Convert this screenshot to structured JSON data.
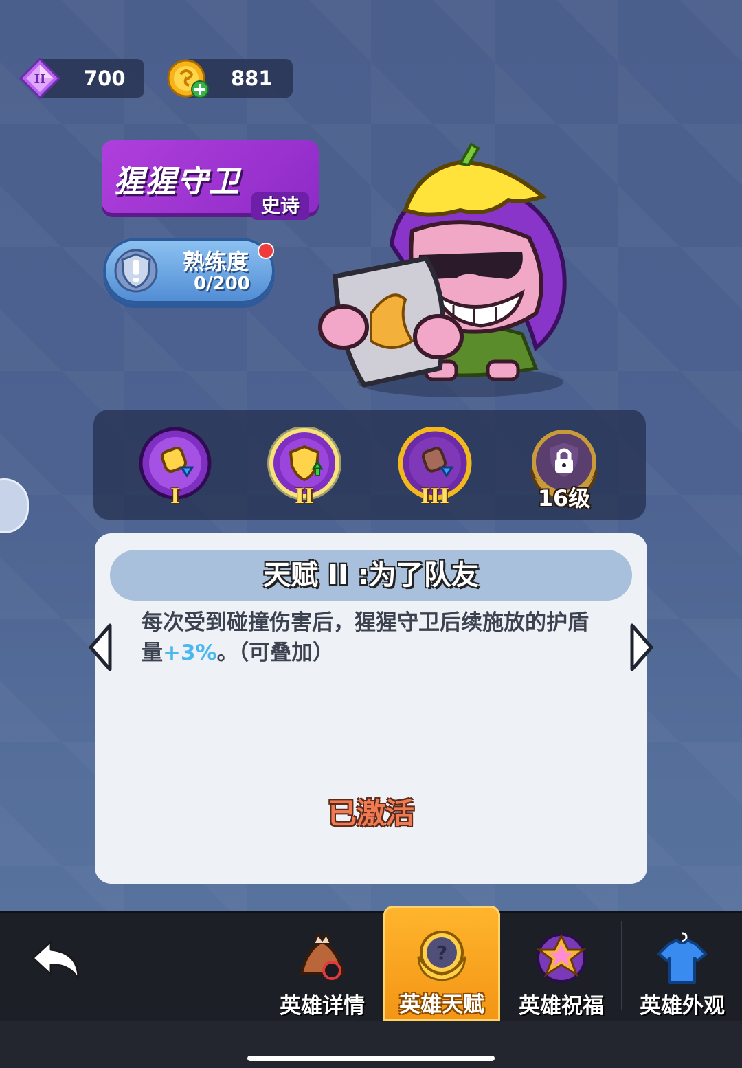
{
  "currency": {
    "gems": {
      "value": "700",
      "icon": "gem-II-icon"
    },
    "coins": {
      "value": "881",
      "icon": "coin-plus-icon"
    }
  },
  "hero": {
    "name": "猩猩守卫",
    "rarity": "史诗",
    "mastery_label": "熟练度",
    "mastery_value": "0/200"
  },
  "talents": [
    {
      "roman": "I",
      "state": "unlocked"
    },
    {
      "roman": "II",
      "state": "selected"
    },
    {
      "roman": "III",
      "state": "unlocked"
    },
    {
      "level": "16级",
      "state": "locked"
    }
  ],
  "detail": {
    "title": "天赋 II :为了队友",
    "desc_before": "每次受到碰撞伤害后，猩猩守卫后续施放的护盾量",
    "desc_highlight": "+3%",
    "desc_after": "。（可叠加）",
    "status": "已激活"
  },
  "nav": {
    "tabs": [
      {
        "label": "英雄详情",
        "icon": "hero-hat-icon"
      },
      {
        "label": "英雄天赋",
        "icon": "talent-medal-icon",
        "active": true
      },
      {
        "label": "英雄祝福",
        "icon": "blessing-star-icon"
      },
      {
        "label": "英雄外观",
        "icon": "shirt-icon"
      }
    ]
  },
  "colors": {
    "accent": "#f39514",
    "rarity_epic": "#9b33d6",
    "highlight": "#48b8ee",
    "activated": "#f07a52"
  }
}
